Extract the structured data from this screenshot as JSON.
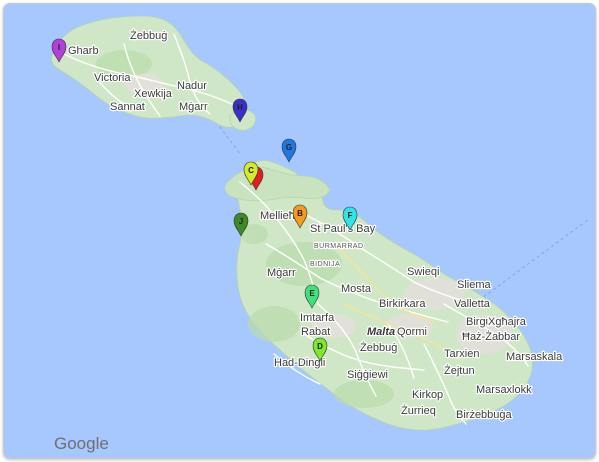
{
  "colors": {
    "sea": "#a6c8ff",
    "land": "#cfe7c6",
    "land_dark": "#b9dbab",
    "road": "#ffffff",
    "road_major": "#f6e9a6"
  },
  "places": {
    "gharb": "Gharb",
    "zebbug_gozo": "Żebbuġ",
    "victoria": "Victoria",
    "nadur": "Nadur",
    "xewkija": "Xewkija",
    "sannat": "Sannat",
    "mgarr_gozo": "Mġarr",
    "mellieha": "Mellieħa",
    "st_pauls_bay": "St Paul's Bay",
    "burmarrad": "BURMARRAD",
    "bidnija": "BIDNIJA",
    "mgarr": "Mġarr",
    "swieqi": "Swieqi",
    "sliema": "Sliema",
    "mosta": "Mosta",
    "birkirkara": "Birkirkara",
    "valletta": "Valletta",
    "imtarfa": "Imtarfa",
    "birgu": "Birgu",
    "xghajra": "Xgħajra",
    "rabat": "Rabat",
    "malta": "Malta",
    "qormi": "Qormi",
    "haz_zabbar": "Ħaż-Żabbar",
    "zebbug": "Żebbuġ",
    "tarxien": "Tarxien",
    "had_dingli": "Had-Dingli",
    "zejtun": "Żejtun",
    "marsaskala": "Marsaskala",
    "siggiewi": "Siġġiewi",
    "marsaxlokk": "Marsaxlokk",
    "kirkop": "Kirkop",
    "zurrieq": "Żurrieq",
    "birzebbuga": "Birżebbuġa"
  },
  "markers": [
    {
      "letter": "I",
      "color": "#b23fd9",
      "name": "marker-i"
    },
    {
      "letter": "H",
      "color": "#3b2fc9",
      "name": "marker-h"
    },
    {
      "letter": "G",
      "color": "#1f78e0",
      "name": "marker-g"
    },
    {
      "letter": "C",
      "color": "#d7ea2a",
      "name": "marker-c"
    },
    {
      "letter": "",
      "color": "#e01f1f",
      "name": "marker-a"
    },
    {
      "letter": "B",
      "color": "#f59a1b",
      "name": "marker-b"
    },
    {
      "letter": "F",
      "color": "#2ee6e6",
      "name": "marker-f"
    },
    {
      "letter": "J",
      "color": "#3f8a26",
      "name": "marker-j"
    },
    {
      "letter": "E",
      "color": "#3fe27a",
      "name": "marker-e"
    },
    {
      "letter": "D",
      "color": "#7fe82a",
      "name": "marker-d"
    }
  ],
  "brand": "Google"
}
